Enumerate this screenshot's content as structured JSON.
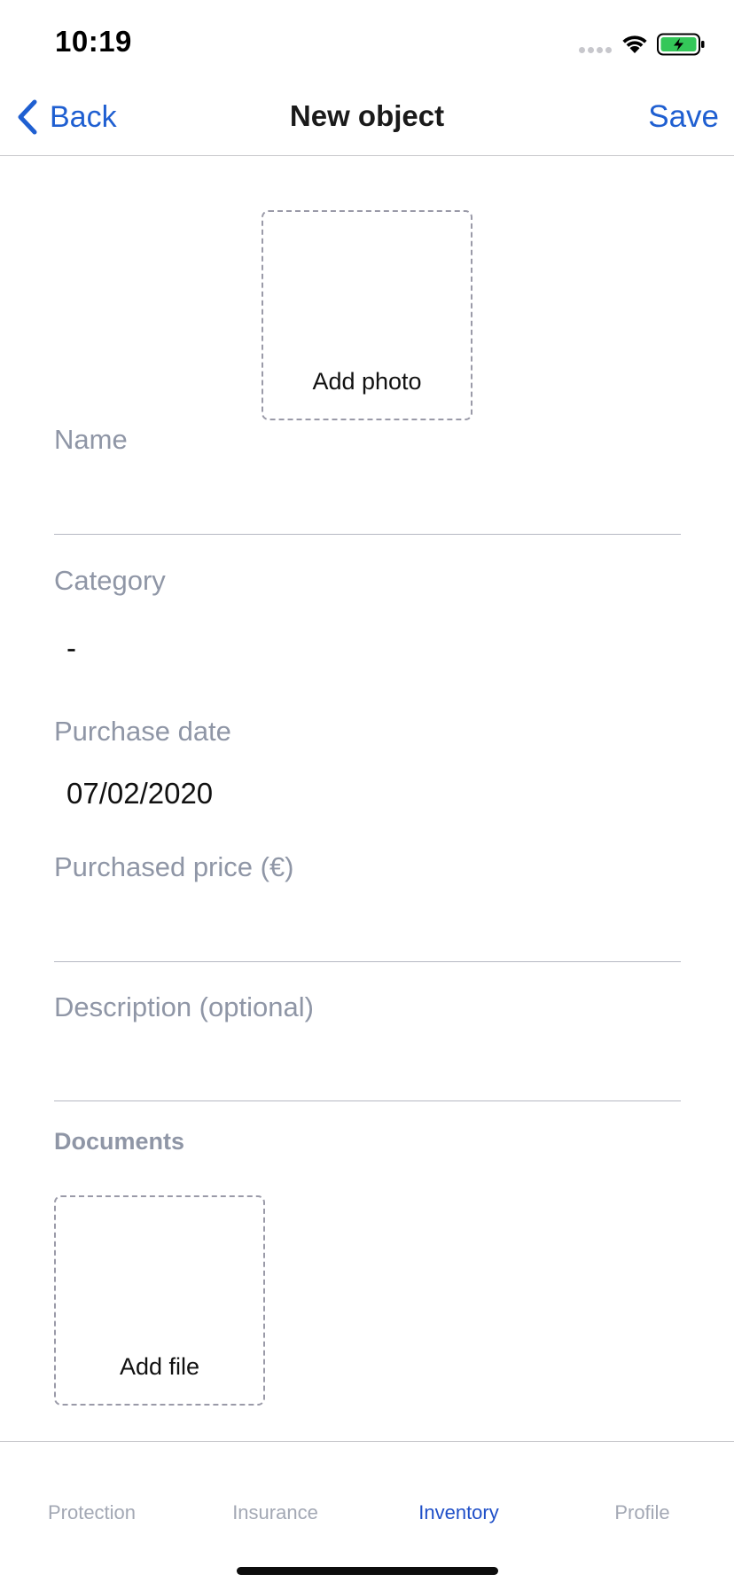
{
  "status_bar": {
    "time": "10:19"
  },
  "nav": {
    "back_label": "Back",
    "title": "New object",
    "save_label": "Save"
  },
  "photo": {
    "add_label": "Add photo"
  },
  "form": {
    "name": {
      "label": "Name",
      "value": ""
    },
    "category": {
      "label": "Category",
      "value": "-"
    },
    "purchase_date": {
      "label": "Purchase date",
      "value": "07/02/2020"
    },
    "purchased_price": {
      "label": "Purchased price (€)",
      "value": ""
    },
    "description": {
      "label": "Description (optional)",
      "value": ""
    }
  },
  "documents": {
    "heading": "Documents",
    "add_label": "Add file"
  },
  "tabs": [
    {
      "label": "Protection",
      "active": false
    },
    {
      "label": "Insurance",
      "active": false
    },
    {
      "label": "Inventory",
      "active": true
    },
    {
      "label": "Profile",
      "active": false
    }
  ],
  "colors": {
    "accent": "#1f5fd1",
    "tab_active": "#1f4fc8",
    "label_gray": "#8f96a6",
    "battery_green": "#34c759"
  },
  "icons": {
    "back": "chevron-left-icon",
    "wifi": "wifi-icon",
    "battery": "battery-charging-icon",
    "signal": "cellular-signal-icon"
  }
}
